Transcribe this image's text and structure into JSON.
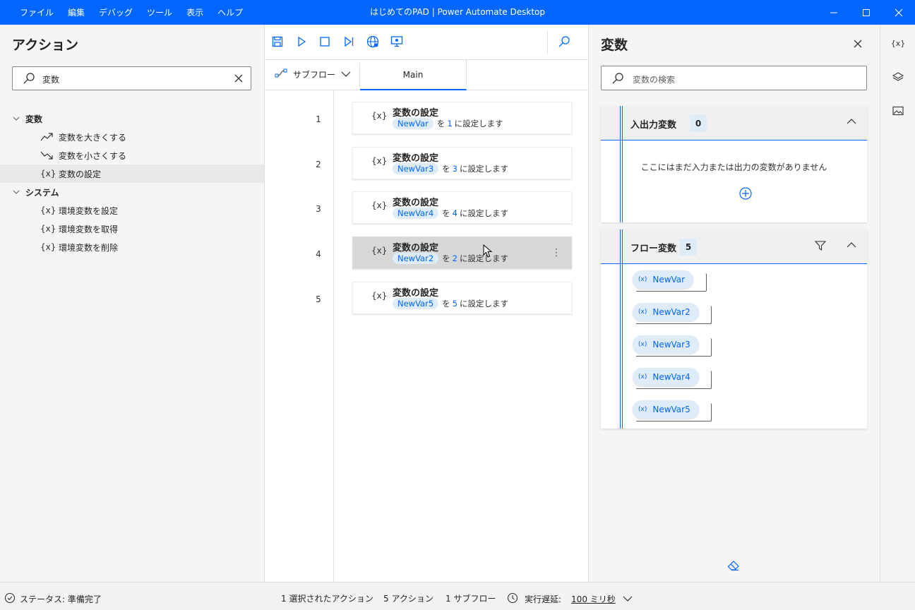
{
  "window": {
    "title": "はじめてのPAD | Power Automate Desktop",
    "menu": [
      "ファイル",
      "編集",
      "デバッグ",
      "ツール",
      "表示",
      "ヘルプ"
    ]
  },
  "actions_panel": {
    "title": "アクション",
    "search_value": "変数",
    "categories": [
      {
        "label": "変数",
        "items": [
          {
            "label": "変数を大きくする",
            "icon": "trend-up-icon"
          },
          {
            "label": "変数を小さくする",
            "icon": "trend-down-icon"
          },
          {
            "label": "変数の設定",
            "icon": "variable-icon",
            "glyph": "{x}"
          }
        ]
      },
      {
        "label": "システム",
        "items": [
          {
            "label": "環境変数を設定",
            "icon": "variable-icon",
            "glyph": "{x}"
          },
          {
            "label": "環境変数を取得",
            "icon": "variable-icon",
            "glyph": "{x}"
          },
          {
            "label": "環境変数を削除",
            "icon": "variable-icon",
            "glyph": "{x}"
          }
        ]
      }
    ]
  },
  "designer": {
    "subflow_label": "サブフロー",
    "main_tab": "Main",
    "steps": [
      {
        "num": "1",
        "glyph": "{x}",
        "title": "変数の設定",
        "var": "NewVar",
        "wo": "を",
        "value": "1",
        "suffix": "に設定します"
      },
      {
        "num": "2",
        "glyph": "{x}",
        "title": "変数の設定",
        "var": "NewVar3",
        "wo": "を",
        "value": "3",
        "suffix": "に設定します"
      },
      {
        "num": "3",
        "glyph": "{x}",
        "title": "変数の設定",
        "var": "NewVar4",
        "wo": "を",
        "value": "4",
        "suffix": "に設定します"
      },
      {
        "num": "4",
        "glyph": "{x}",
        "title": "変数の設定",
        "var": "NewVar2",
        "wo": "を",
        "value": "2",
        "suffix": "に設定します"
      },
      {
        "num": "5",
        "glyph": "{x}",
        "title": "変数の設定",
        "var": "NewVar5",
        "wo": "を",
        "value": "5",
        "suffix": "に設定します"
      }
    ]
  },
  "variables_panel": {
    "title": "変数",
    "search_placeholder": "変数の検索",
    "io_section": {
      "title": "入出力変数",
      "count": "0",
      "empty_text": "ここにはまだ入力または出力の変数がありません"
    },
    "flow_section": {
      "title": "フロー変数",
      "count": "5",
      "glyph": "(x)",
      "items": [
        "NewVar",
        "NewVar2",
        "NewVar3",
        "NewVar4",
        "NewVar5"
      ]
    }
  },
  "rail": {
    "variables_glyph": "{x}"
  },
  "status": {
    "state": "ステータス: 準備完了",
    "selected": "1 選択されたアクション",
    "actions": "5 アクション",
    "subflows": "1 サブフロー",
    "delay_label": "実行遅延:",
    "delay_value": "100 ミリ秒"
  },
  "colors": {
    "accent": "#0066ff",
    "pill_bg": "#deecf9",
    "panel_bg": "#f5f5f5"
  }
}
